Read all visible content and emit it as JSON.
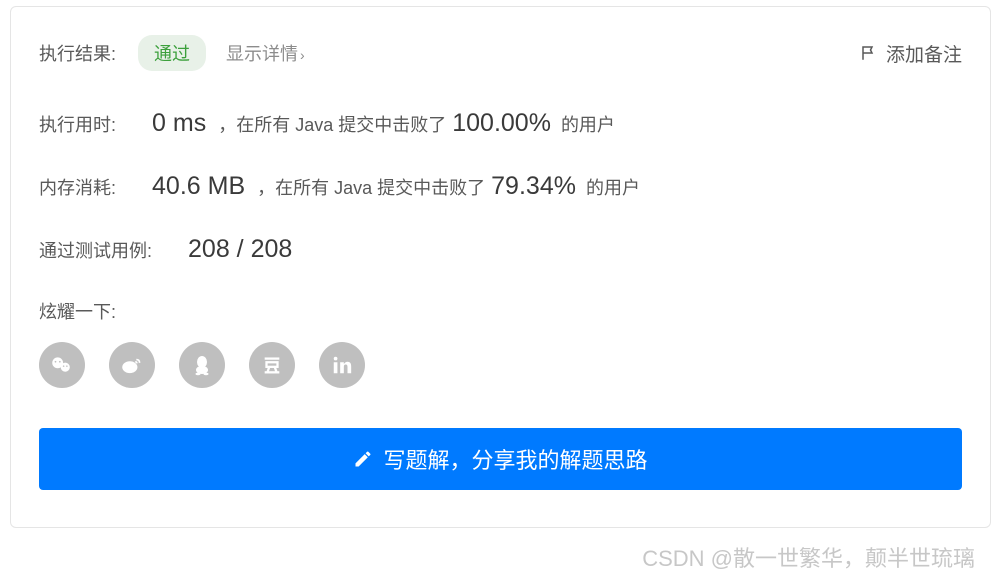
{
  "header": {
    "result_label": "执行结果:",
    "status_badge": "通过",
    "detail_link": "显示详情",
    "add_remark": "添加备注"
  },
  "runtime": {
    "label": "执行用时:",
    "value": "0 ms",
    "mid_text": "，在所有 Java 提交中击败了",
    "percent": "100.00%",
    "suffix": "的用户"
  },
  "memory": {
    "label": "内存消耗:",
    "value": "40.6 MB",
    "mid_text": "，在所有 Java 提交中击败了",
    "percent": "79.34%",
    "suffix": "的用户"
  },
  "testcases": {
    "label": "通过测试用例:",
    "value": "208 / 208"
  },
  "share": {
    "label": "炫耀一下:"
  },
  "button": {
    "write_solution": "写题解，分享我的解题思路"
  },
  "watermark": "CSDN @散一世繁华，颠半世琉璃"
}
